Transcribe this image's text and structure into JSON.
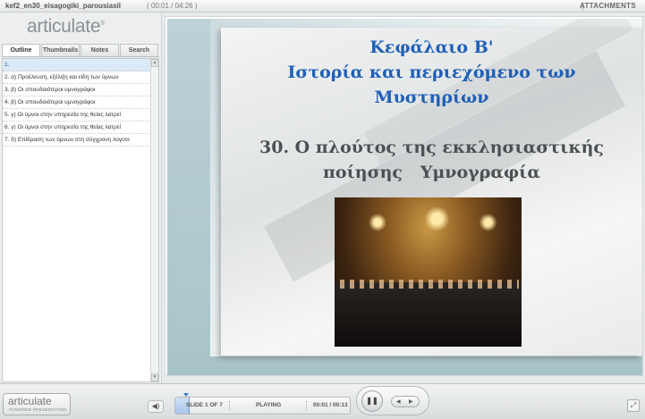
{
  "titlebar": {
    "file_name": "kef2_en30_eisagogiki_parousiasil",
    "time": "( 00:01 / 04:26 )",
    "attachments_label": "ATTACHMENTS"
  },
  "sidebar": {
    "logo_text": "articulate",
    "tabs": [
      {
        "label": "Outline",
        "active": true
      },
      {
        "label": "Thumbnails",
        "active": false
      },
      {
        "label": "Notes",
        "active": false
      },
      {
        "label": "Search",
        "active": false
      }
    ],
    "outline_items": [
      "1.",
      "2. α) Προέλευση, εξέλιξη και είδη των ύμνων",
      "3. β) Οι σπουδαιότεροι υμνογράφοι",
      "4. β) Οι σπουδαιότεροι υμνογράφοι",
      "5. γ) Οι ύμνοι στην υπηρεσία της θείας λατρεί",
      "6. γ) Οι ύμνοι στην υπηρεσία της θείας λατρεί",
      "7. δ) Επίδραση των ύμνων στη σύγχρονη λογοτε"
    ],
    "selected_index": 0,
    "scroll_up_icon": "arrow-up-icon",
    "scroll_down_icon": "arrow-down-icon"
  },
  "slide": {
    "chapter_line1": "Κεφάλαιο Β'",
    "chapter_line2": "Ιστορία και περιεχόμενο των",
    "chapter_line3": "Μυστηρίων",
    "topic_line1": "30. Ο πλούτος της εκκλησιαστικής",
    "topic_line2": "ποίησης   Υμνογραφία",
    "photo_description_icon": "choir-in-church-photo"
  },
  "controls": {
    "logo_word": "articulate",
    "logo_sub": "POWERED PRESENTATION",
    "volume_icon": "speaker-icon",
    "slide_counter": "SLIDE 1 OF 7",
    "status": "PLAYING",
    "time": "00:01 / 00:13",
    "progress_fraction": 0.08,
    "play_pause_icon": "pause-icon",
    "prev_icon": "previous-icon",
    "next_icon": "next-icon",
    "fullscreen_icon": "fullscreen-icon"
  },
  "colors": {
    "title_blue": "#1f5fb8",
    "topic_gray": "#4d5052",
    "selection": "#dce9f7"
  }
}
